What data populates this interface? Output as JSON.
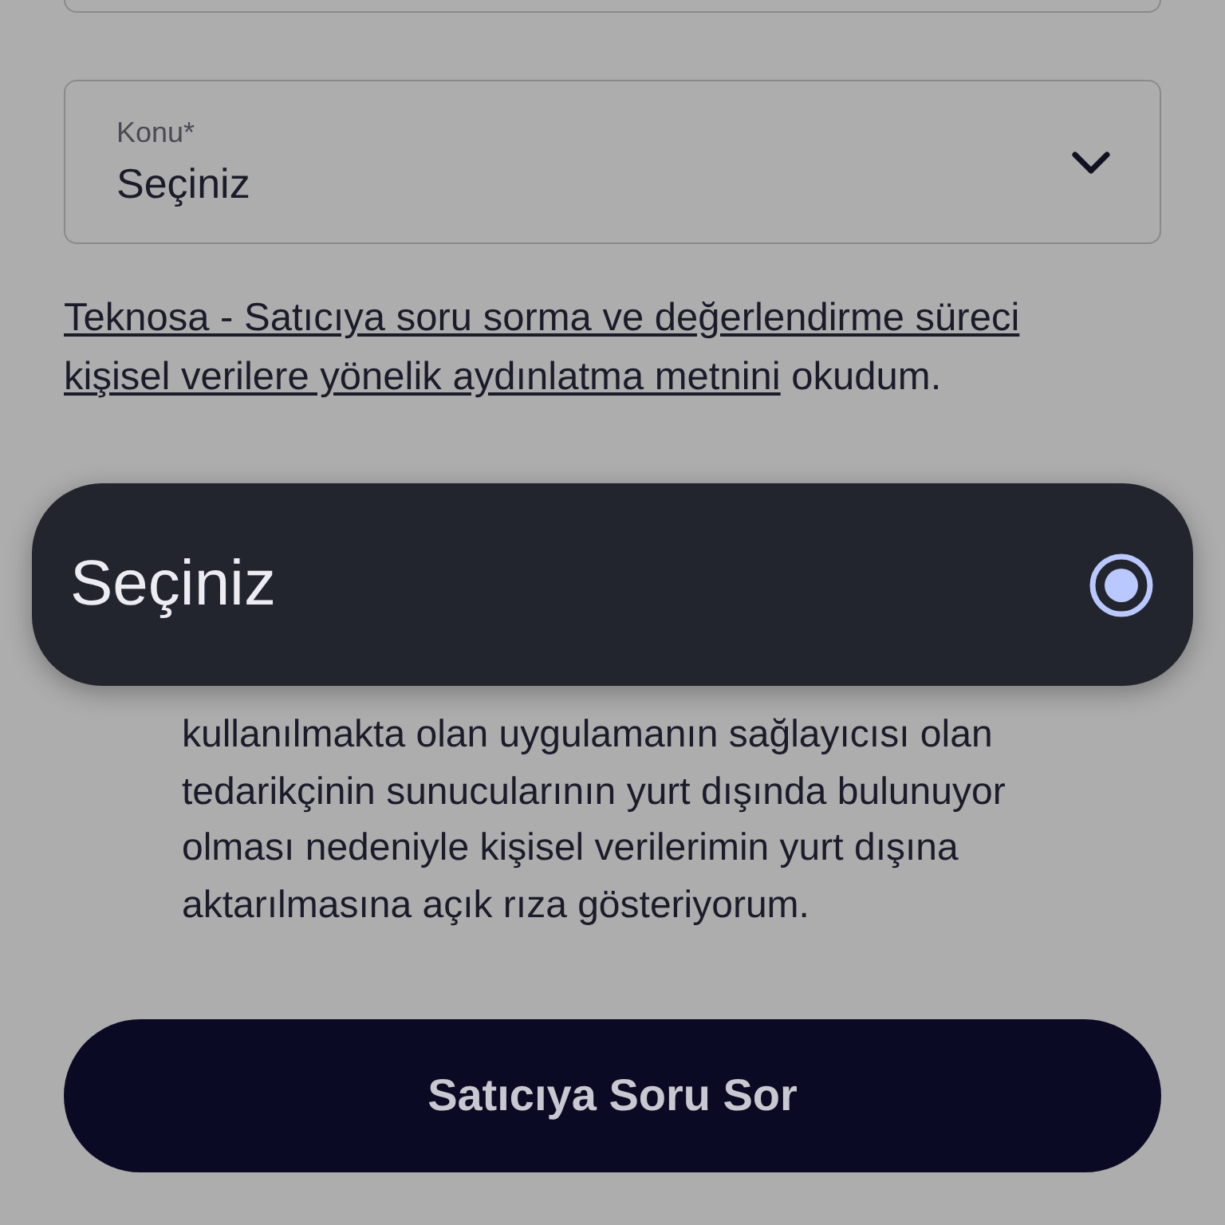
{
  "previous_field": {
    "kind": "field"
  },
  "subject_field": {
    "label": "Konu*",
    "value": "Seçiniz"
  },
  "consent_notice": {
    "links": [
      "Teknosa - Satıcıya soru sorma ve değerlendirme süreci",
      "kişisel verilere yönelik aydınlatma metnini"
    ],
    "suffix": " okudum."
  },
  "transfer_consent": {
    "text": "kullanılmakta olan uygulamanın sağlayıcısı olan tedarikçinin sunucularının yurt dışında bulunuyor olması nedeniyle kişisel verilerimin yurt dışına aktarılmasına açık rıza gösteriyorum."
  },
  "submit_button": {
    "label": "Satıcıya Soru Sor"
  },
  "dropdown_menu": {
    "options": [
      {
        "label": "Seçiniz",
        "selected": true
      }
    ]
  }
}
